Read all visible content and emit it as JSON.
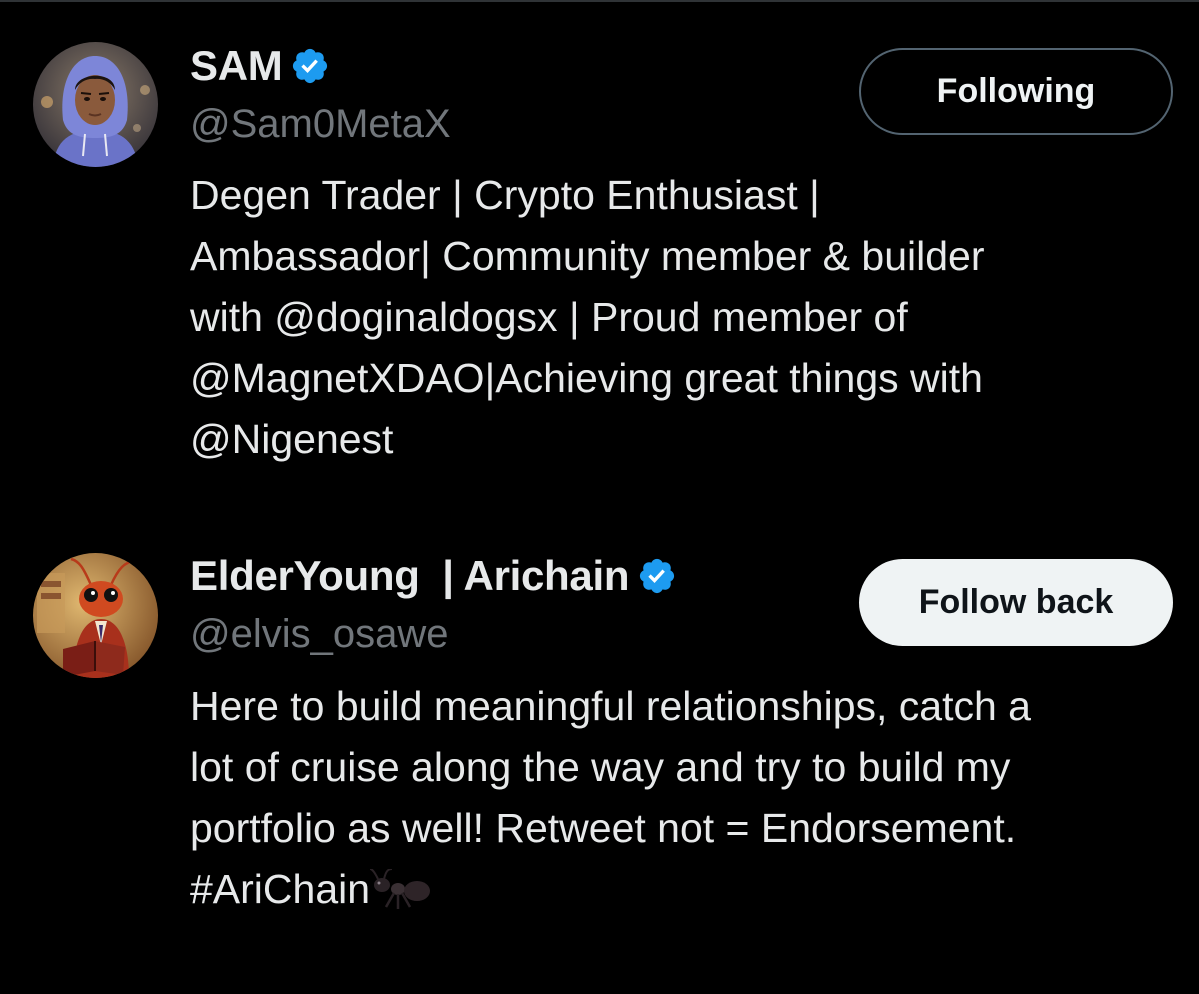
{
  "colors": {
    "background": "#000000",
    "primary_text": "#e7e9ea",
    "secondary_text": "#71767b",
    "verified_badge": "#1d9bf0",
    "follow_back_bg": "#eff3f4"
  },
  "users": [
    {
      "display_name": "SAM",
      "verified": true,
      "verified_icon": "verified-badge-icon",
      "handle": "@Sam0MetaX",
      "avatar_icon": "hooded-boy-avatar",
      "button_label": "Following",
      "bio_lines": [
        "Degen Trader | Crypto Enthusiast |",
        "Ambassador| Community member & builder",
        "with @doginaldogsx | Proud member of",
        "@MagnetXDAO|Achieving great things with",
        "@Nigenest"
      ]
    },
    {
      "display_name": "ElderYoung  | Arichain",
      "verified": true,
      "verified_icon": "verified-badge-icon",
      "handle": "@elvis_osawe",
      "avatar_icon": "ant-reading-avatar",
      "button_label": "Follow back",
      "bio_lines": [
        "Here to build meaningful relationships, catch a",
        "lot of cruise along the way and try to build my",
        "portfolio as well! Retweet not = Endorsement.",
        "#AriChain"
      ],
      "bio_trailing_icon": "ant-emoji-icon"
    }
  ]
}
